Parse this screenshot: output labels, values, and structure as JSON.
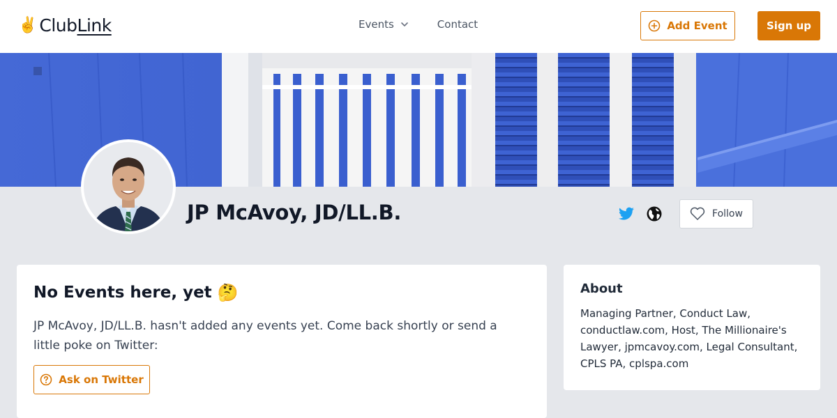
{
  "header": {
    "logo_prefix": "Club",
    "logo_suffix": "Link",
    "logo_emoji": "✌️",
    "nav": {
      "events_label": "Events",
      "contact_label": "Contact"
    },
    "add_event_label": "Add Event",
    "signup_label": "Sign up"
  },
  "profile": {
    "name": "JP McAvoy, JD/LL.B.",
    "social": [
      "twitter-icon",
      "globe-icon"
    ],
    "follow_label": "Follow"
  },
  "events_card": {
    "title": "No Events here, yet",
    "title_emoji": "🤔",
    "body": "JP McAvoy, JD/LL.B. hasn't added any events yet. Come back shortly or send a little poke on Twitter:",
    "ask_label": "Ask on Twitter"
  },
  "about_card": {
    "title": "About",
    "text": "Managing Partner, Conduct Law, conductlaw.com, Host, The Millionaire's Lawyer, jpmcavoy.com, Legal Consultant, CPLS PA, cplspa.com"
  },
  "colors": {
    "accent": "#d97706",
    "twitter": "#1da1f2",
    "page_bg": "#e5e7eb",
    "banner_blue": "#3b5fcf"
  }
}
